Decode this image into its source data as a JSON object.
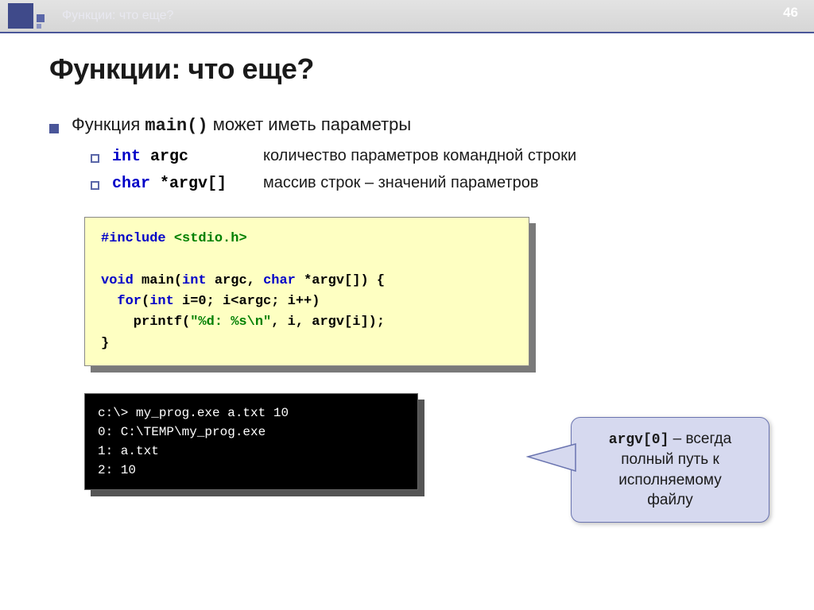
{
  "header": {
    "breadcrumb": "Функции: что еще?",
    "page_number": "46"
  },
  "title": "Функции: что еще?",
  "bullet1": {
    "prefix": "Функция ",
    "code": "main()",
    "suffix": " может иметь параметры"
  },
  "params": {
    "argc": {
      "kw": "int",
      "name": " argc",
      "desc": "количество параметров командной строки"
    },
    "argv": {
      "kw": "char",
      "name": " *argv[]",
      "desc": "массив строк – значений параметров"
    }
  },
  "code": {
    "l1a": "#include",
    "l1b": " <stdio.h>",
    "l3a": "void",
    "l3b": " main(",
    "l3c": "int",
    "l3d": " argc, ",
    "l3e": "char",
    "l3f": " *argv[]) {",
    "l4a": "  for",
    "l4b": "(",
    "l4c": "int",
    "l4d": " i=0; i<argc; i++)",
    "l5a": "    printf(",
    "l5b": "\"%d: %s\\n\"",
    "l5c": ", i, argv[i]);",
    "l6": "}"
  },
  "terminal": "c:\\> my_prog.exe a.txt 10\n0: C:\\TEMP\\my_prog.exe\n1: a.txt\n2: 10",
  "callout": {
    "code": "argv[0]",
    "text1": " – всегда",
    "text2": "полный путь к",
    "text3": "исполняемому",
    "text4": "файлу"
  }
}
